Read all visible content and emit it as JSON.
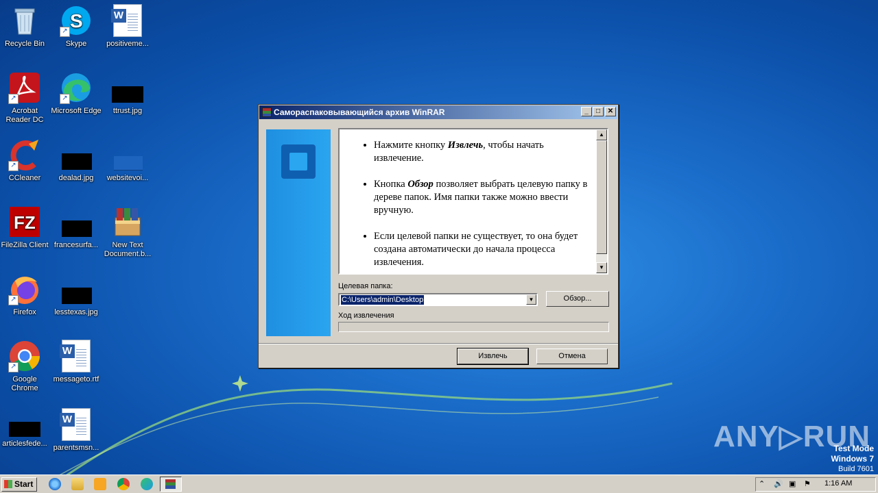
{
  "desktop": {
    "icons": [
      {
        "label": "Recycle Bin"
      },
      {
        "label": "Skype"
      },
      {
        "label": "positiveme..."
      },
      {
        "label": "Acrobat\nReader DC"
      },
      {
        "label": "Microsoft Edge"
      },
      {
        "label": "ttrust.jpg"
      },
      {
        "label": "CCleaner"
      },
      {
        "label": "dealad.jpg"
      },
      {
        "label": "websitevoi..."
      },
      {
        "label": "FileZilla Client"
      },
      {
        "label": "francesurfa..."
      },
      {
        "label": "New Text\nDocument.b..."
      },
      {
        "label": "Firefox"
      },
      {
        "label": "lesstexas.jpg"
      },
      {
        "label": "Google\nChrome"
      },
      {
        "label": "messageto.rtf"
      },
      {
        "label": "articlesfede..."
      },
      {
        "label": "parentsmsn..."
      }
    ]
  },
  "window": {
    "title": "Самораспаковывающийся архив WinRAR",
    "bullets": [
      {
        "pre": "Нажмите кнопку ",
        "em": "Извлечь",
        "post": ", чтобы начать извлечение."
      },
      {
        "pre": "Кнопка ",
        "em": "Обзор",
        "post": " позволяет выбрать целевую папку в дереве папок. Имя папки также можно ввести вручную."
      },
      {
        "pre": "Если целевой папки не существует, то она будет создана автоматически до начала процесса извлечения.",
        "em": "",
        "post": ""
      }
    ],
    "dest_label": "Целевая папка:",
    "dest_value": "C:\\Users\\admin\\Desktop",
    "browse_label": "Обзор...",
    "progress_label": "Ход извлечения",
    "progress_value": 0,
    "extract_label": "Извлечь",
    "cancel_label": "Отмена"
  },
  "taskbar": {
    "start_label": "Start",
    "clock": "1:16 AM"
  },
  "watermark": {
    "text": "ANY▷RUN",
    "line1": "Test Mode",
    "line2": "Windows 7",
    "line3": "Build 7601"
  }
}
